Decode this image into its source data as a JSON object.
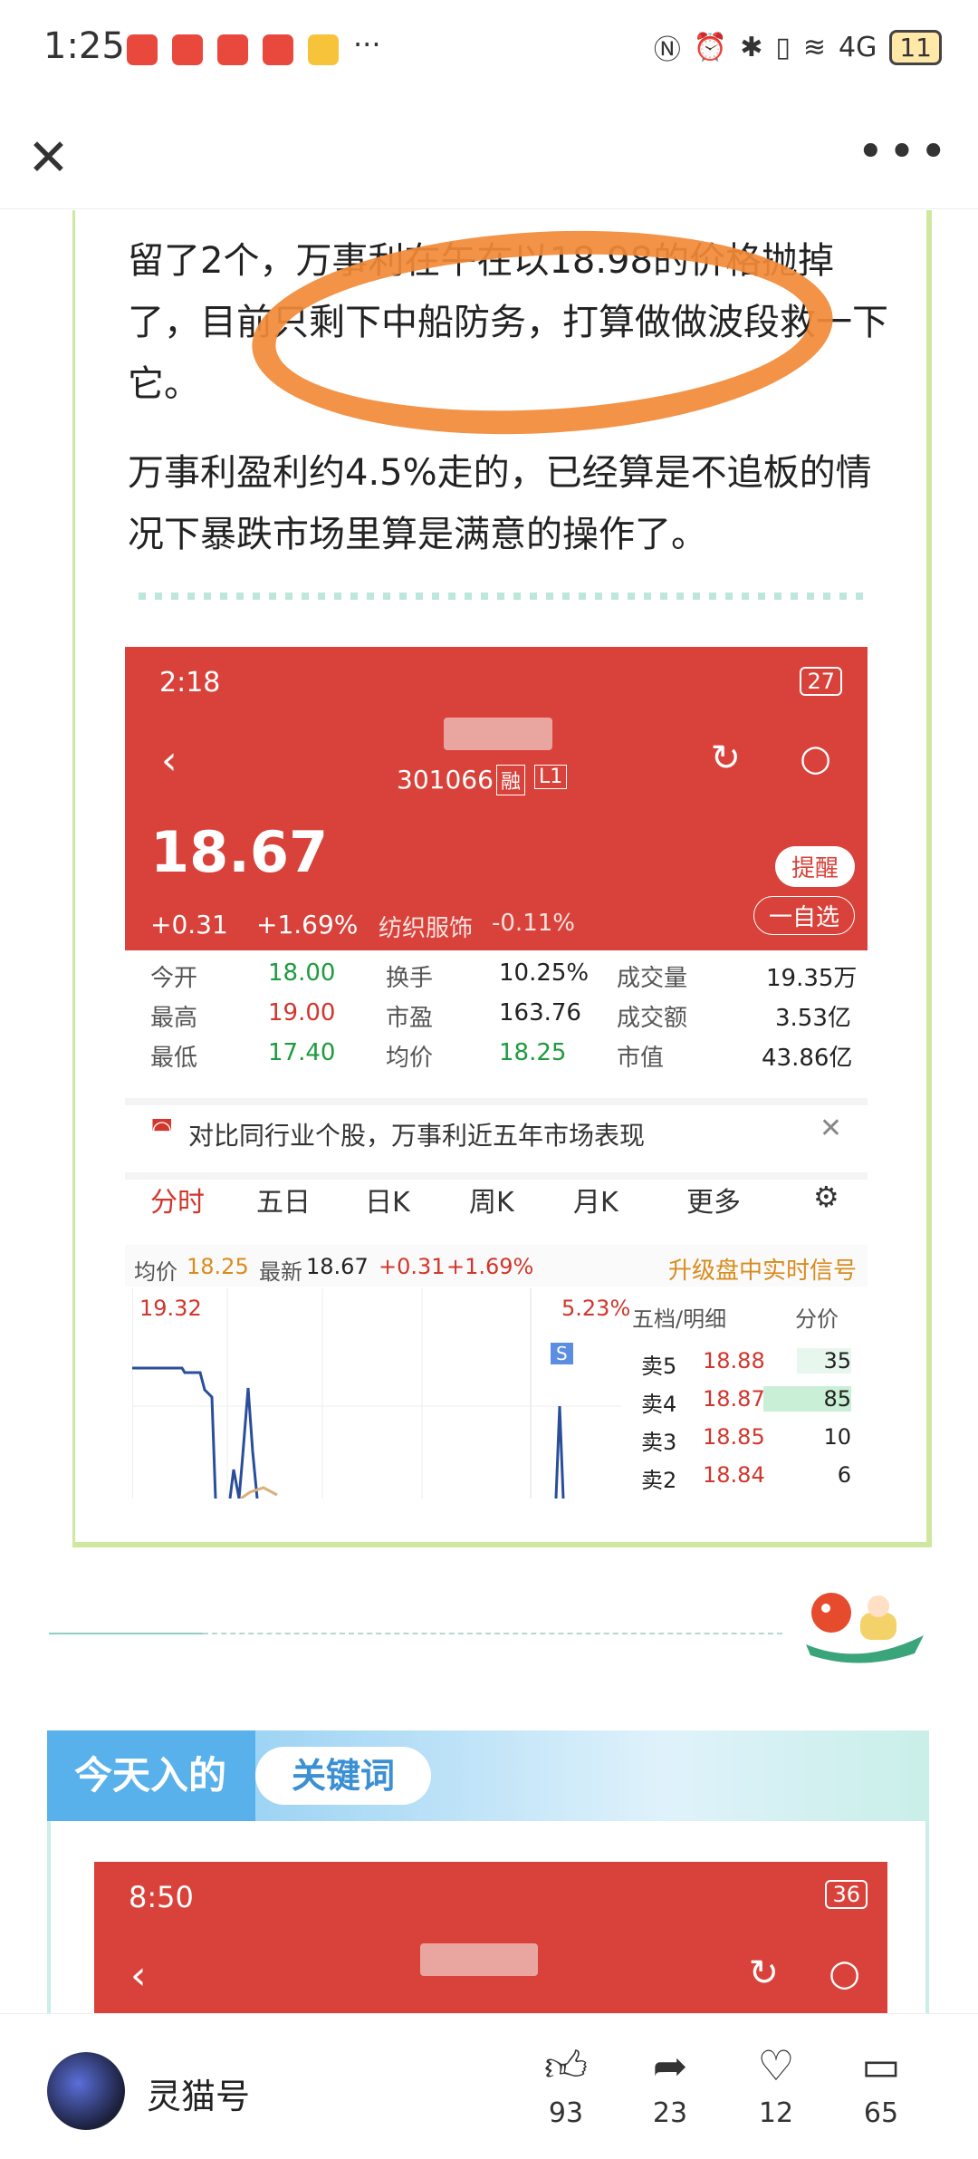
{
  "status_bar": {
    "time": "1:25",
    "more": "···",
    "network": "4G",
    "battery": "11"
  },
  "top_bar": {
    "close": "✕",
    "more": "•••"
  },
  "article": {
    "para1": "留了2个，万事利在午在以18.98的价格抛掉了，目前只剩下中船防务，打算做做波段救一下它。",
    "para2": "万事利盈利约4.5%走的，已经算是不追板的情况下暴跌市场里算是满意的操作了。"
  },
  "stock_screenshot": {
    "status": {
      "time": "2:18",
      "battery": "27"
    },
    "code": "301066",
    "tag": "融",
    "level": "L1",
    "price": "18.67",
    "change": "+0.31",
    "change_pct": "+1.69%",
    "sector": "纺织服饰",
    "sector_pct": "-0.11%",
    "remind": "提醒",
    "watchlist": "一自选",
    "stats": [
      [
        "今开",
        "18.00",
        "换手",
        "10.25%",
        "成交量",
        "19.35万"
      ],
      [
        "最高",
        "19.00",
        "市盈",
        "163.76",
        "成交额",
        "3.53亿"
      ],
      [
        "最低",
        "17.40",
        "均价",
        "18.25",
        "市值",
        "43.86亿"
      ]
    ],
    "banner": "对比同行业个股，万事利近五年市场表现",
    "tabs": [
      "分时",
      "五日",
      "日K",
      "周K",
      "月K",
      "更多"
    ],
    "info_line": {
      "avg_label": "均价",
      "avg": "18.25",
      "latest_label": "最新",
      "latest": "18.67",
      "chg": "+0.31",
      "chg_pct": "+1.69%",
      "upgrade": "升级盘中实时信号"
    },
    "chart": {
      "high": "19.32",
      "high_pct": "5.23%",
      "marker": "S"
    },
    "orderbook": {
      "header_left": "五档/明细",
      "header_right": "分价",
      "rows": [
        {
          "label": "卖5",
          "price": "18.88",
          "vol": "35"
        },
        {
          "label": "卖4",
          "price": "18.87",
          "vol": "85"
        },
        {
          "label": "卖3",
          "price": "18.85",
          "vol": "10"
        },
        {
          "label": "卖2",
          "price": "18.84",
          "vol": "6"
        }
      ]
    }
  },
  "section": {
    "title": "今天入的",
    "subtitle": "关键词"
  },
  "stock_screenshot2": {
    "time": "8:50",
    "battery": "36"
  },
  "bottom_bar": {
    "author": "灵猫号",
    "likes": "93",
    "shares": "23",
    "favorites": "12",
    "comments": "65"
  },
  "colors": {
    "accent_red": "#d9423a",
    "annotation_orange": "#f28a37",
    "section_blue": "#59b1ec"
  }
}
